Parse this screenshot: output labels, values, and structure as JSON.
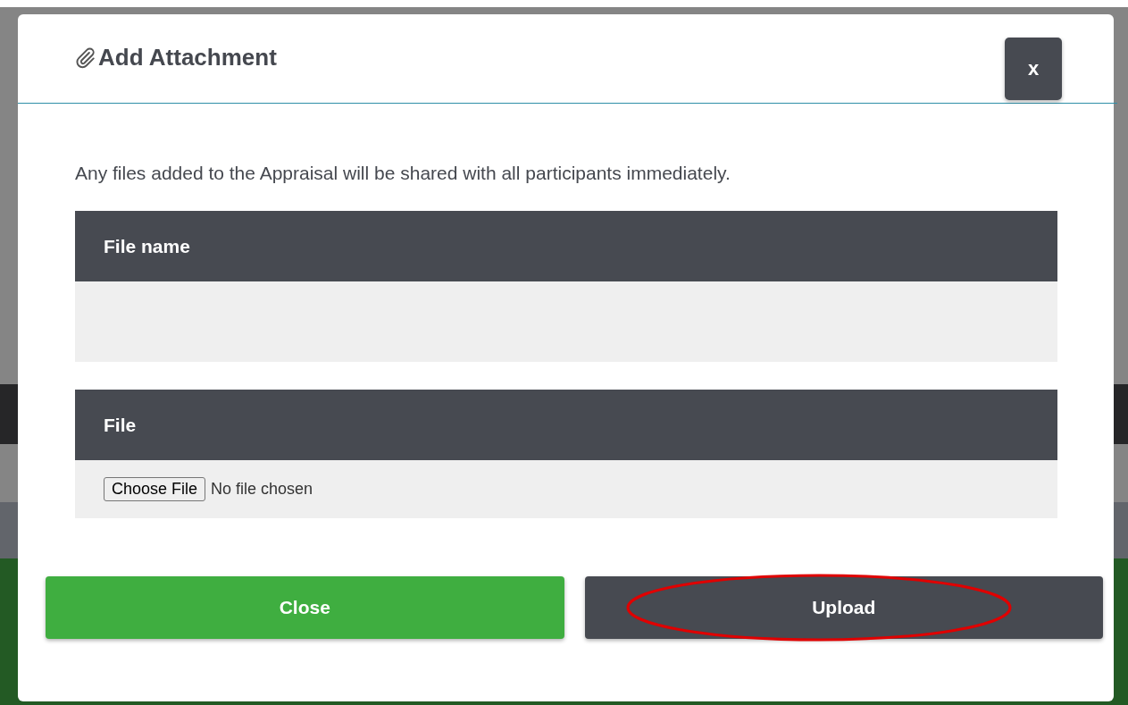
{
  "dialog": {
    "title": "Add Attachment",
    "close_label": "x",
    "message": "Any files added to the Appraisal will be shared with all participants immediately.",
    "sections": [
      {
        "heading": "File name",
        "kind": "empty"
      },
      {
        "heading": "File",
        "kind": "file",
        "choose_label": "Choose File",
        "status": "No file chosen"
      }
    ],
    "buttons": [
      {
        "label": "Close",
        "kind": "primary",
        "highlighted": false
      },
      {
        "label": "Upload",
        "kind": "secondary",
        "highlighted": true
      }
    ]
  }
}
